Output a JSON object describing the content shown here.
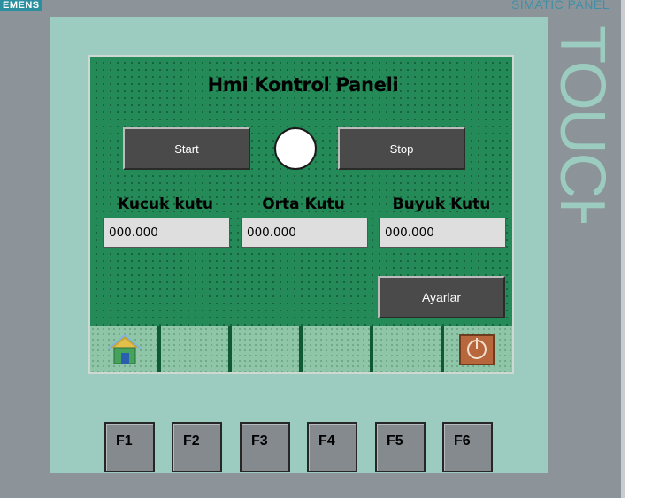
{
  "device": {
    "brand": "EMENS",
    "panel_name": "SIMATIC PANEL",
    "side_text": "TOUCH"
  },
  "screen": {
    "title": "Hmi Kontrol Paneli",
    "start_label": "Start",
    "stop_label": "Stop",
    "lamp_state": "off",
    "lamp_color": "#ffffff",
    "fields": [
      {
        "label": "Kucuk kutu",
        "value": "000.000"
      },
      {
        "label": "Orta Kutu",
        "value": "000.000"
      },
      {
        "label": "Buyuk Kutu",
        "value": "000.000"
      }
    ],
    "settings_label": "Ayarlar",
    "nav": {
      "home_icon": "home-icon",
      "exit_icon": "power-icon"
    }
  },
  "function_keys": [
    "F1",
    "F2",
    "F3",
    "F4",
    "F5",
    "F6"
  ],
  "colors": {
    "screen_bg": "#248a58",
    "bezel": "#9bccbf",
    "button": "#4a4a4a",
    "field_bg": "#dedede"
  }
}
